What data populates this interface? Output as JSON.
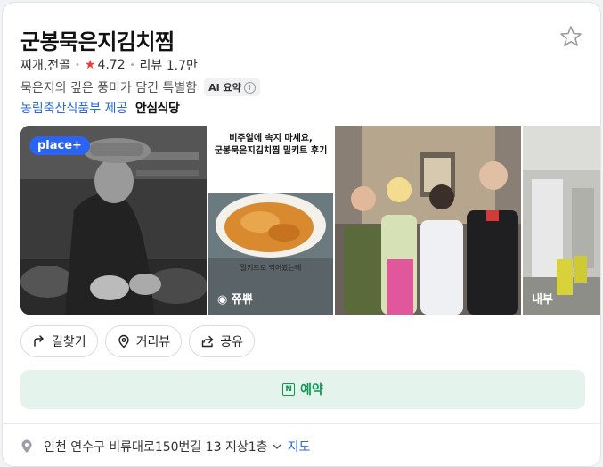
{
  "place": {
    "name": "군봉묵은지김치찜",
    "category": "찌개,전골",
    "rating": "4.72",
    "reviews": "리뷰 1.7만",
    "description": "묵은지의 깊은 풍미가 담긴 특별함",
    "ai_badge": "AI 요약",
    "provider": "농림축산식품부 제공",
    "certification": "안심식당"
  },
  "photos": {
    "badge": "place+",
    "poster_headline_1": "비주얼에 속지 마세요,",
    "poster_headline_2": "군봉묵은지김치찜 밀키트 후기",
    "poster_caption": "밀키트로 먹어봤는데",
    "poster_author": "쮸쀼",
    "interior_label": "내부"
  },
  "actions": {
    "directions": "길찾기",
    "street_view": "거리뷰",
    "share": "공유",
    "reserve": "예약"
  },
  "address": {
    "text": "인천 연수구 비류대로150번길 13 지상1층",
    "map_link": "지도"
  },
  "colors": {
    "rating_star": "#f03c3c",
    "link_blue": "#2a6ad8",
    "reserve_green": "#0c9a52",
    "reserve_bg": "#e4f3ec",
    "place_plus_blue": "#2a64f0"
  }
}
